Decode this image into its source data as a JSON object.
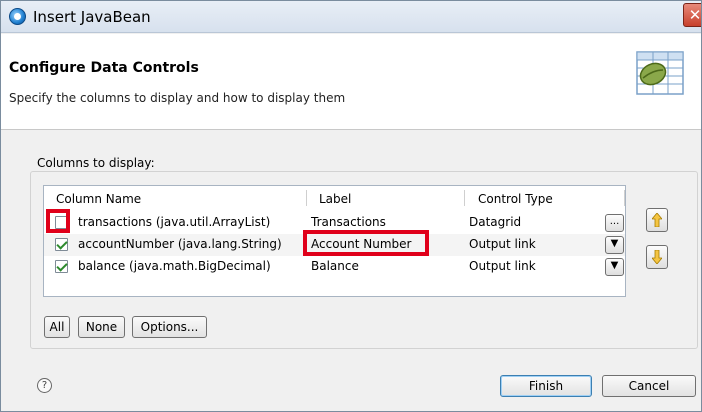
{
  "window": {
    "title": "Insert JavaBean",
    "close_glyph": "✕"
  },
  "header": {
    "title": "Configure Data Controls",
    "description": "Specify the columns to display and how to display them",
    "graphic_icon": "table-bean-icon"
  },
  "columns": {
    "label": "Columns to display:",
    "headers": [
      "Column Name",
      "Label",
      "Control Type"
    ],
    "rows": [
      {
        "checked": false,
        "column_name": "transactions (java.util.ArrayList)",
        "label": "Transactions",
        "control_type": "Datagrid",
        "action": "..."
      },
      {
        "checked": true,
        "column_name": "accountNumber (java.lang.String)",
        "label": "Account Number",
        "control_type": "Output link",
        "action": "▼"
      },
      {
        "checked": true,
        "column_name": "balance (java.math.BigDecimal)",
        "label": "Balance",
        "control_type": "Output link",
        "action": "▼"
      }
    ],
    "highlight_color": "#e0001a"
  },
  "buttons": {
    "all": "All",
    "none": "None",
    "options": "Options...",
    "finish": "Finish",
    "cancel": "Cancel",
    "help": "?"
  },
  "colors": {
    "arrow_fill": "#f5c542",
    "window_bg": "#f0f0f0"
  }
}
